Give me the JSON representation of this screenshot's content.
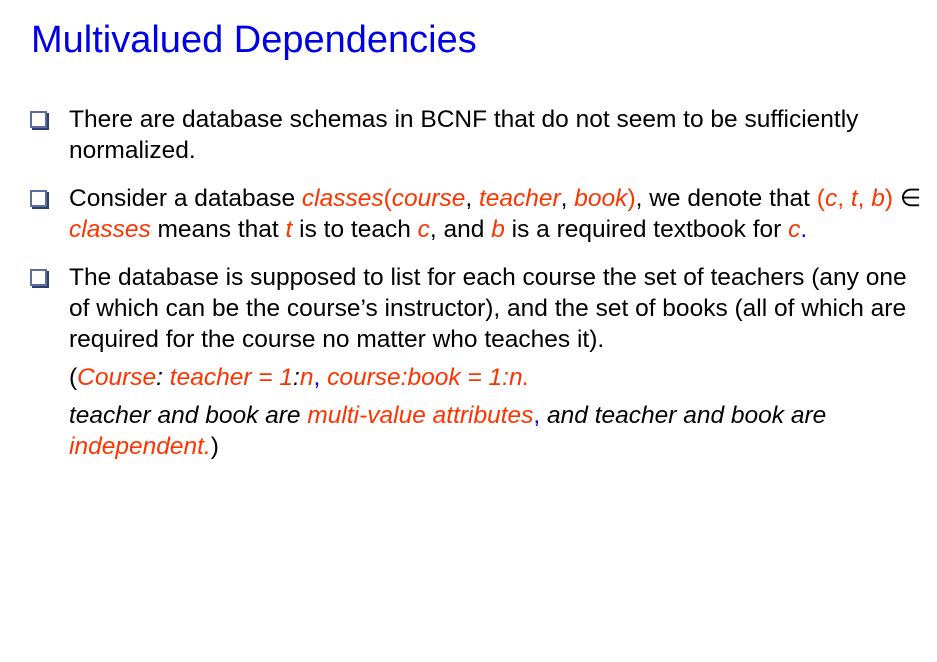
{
  "slide": {
    "title": "Multivalued Dependencies"
  },
  "colors": {
    "title": "#0000e6",
    "highlight": "#ff3300",
    "text": "#000000",
    "bullet_box": "#5a6fa0"
  },
  "bullets": [
    {
      "text": "There are database schemas in BCNF that do not seem to be sufficiently normalized."
    },
    {
      "intro": "Consider a database ",
      "relation": "classes",
      "paren_open": "(",
      "attr_course": "course",
      "comma1": ", ",
      "attr_teacher": "teacher",
      "comma2": ", ",
      "attr_book": "book",
      "paren_close": ")",
      "after_relation": ", we denote that ",
      "tuple_open": "(",
      "tuple_c": "c",
      "tuple_sep1": ", ",
      "tuple_t": "t",
      "tuple_sep2": ", ",
      "tuple_b": "b",
      "tuple_close": ")",
      "member_symbol": " ∈ ",
      "classes_ref": "classes",
      "means_that": " means that ",
      "var_t": "t",
      "is_to_teach": " is to teach ",
      "var_c": "c",
      "and_text": ", and ",
      "var_b": "b",
      "required_text": " is a required textbook for ",
      "var_c2": "c",
      "period": "."
    },
    {
      "text": "The database is supposed to list for each course the set of teachers (any one of which can be the course’s instructor), and the set of books (all of which are required for the course no matter who teaches it).",
      "line2": {
        "open": "(",
        "course_label": "Course",
        "colon1": ": ",
        "teacher_eq": "teacher = 1",
        "colon2": ":",
        "n1": "n",
        "comma": ", ",
        "course_book": "course:book = 1:n."
      },
      "line3": {
        "part1": "teacher and  book are ",
        "multi_value": "multi-value attributes",
        "comma": ",",
        "part2": " and teacher and book are ",
        "independent": "independent.",
        "close": ")"
      }
    }
  ]
}
